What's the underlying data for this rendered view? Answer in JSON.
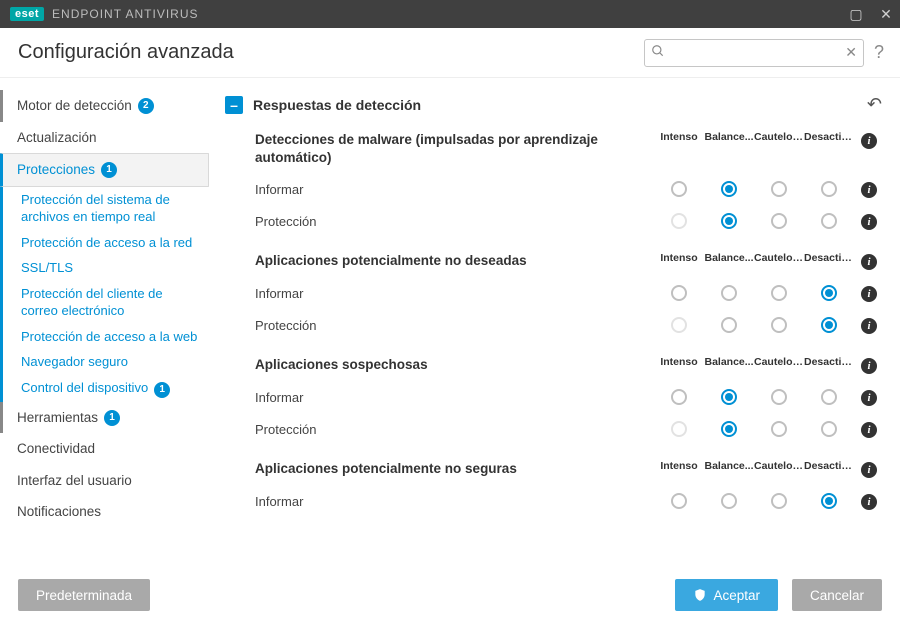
{
  "titlebar": {
    "logo": "eset",
    "product": "ENDPOINT ANTIVIRUS"
  },
  "header": {
    "title": "Configuración avanzada",
    "search_placeholder": "",
    "help": "?"
  },
  "sidebar": {
    "items": [
      {
        "label": "Motor de detección",
        "badge": "2",
        "kind": "top",
        "accent": true
      },
      {
        "label": "Actualización",
        "kind": "top"
      },
      {
        "label": "Protecciones",
        "badge": "1",
        "kind": "top",
        "active": true
      },
      {
        "label": "Protección del sistema de archivos en tiempo real",
        "kind": "sub"
      },
      {
        "label": "Protección de acceso a la red",
        "kind": "sub"
      },
      {
        "label": "SSL/TLS",
        "kind": "sub"
      },
      {
        "label": "Protección del cliente de correo electrónico",
        "kind": "sub"
      },
      {
        "label": "Protección de acceso a la web",
        "kind": "sub"
      },
      {
        "label": "Navegador seguro",
        "kind": "sub"
      },
      {
        "label": "Control del dispositivo",
        "badge": "1",
        "kind": "sub"
      },
      {
        "label": "Herramientas",
        "badge": "1",
        "kind": "top",
        "accent": true
      },
      {
        "label": "Conectividad",
        "kind": "top"
      },
      {
        "label": "Interfaz del usuario",
        "kind": "top"
      },
      {
        "label": "Notificaciones",
        "kind": "top"
      }
    ]
  },
  "section": {
    "title": "Respuestas de detección"
  },
  "columns": [
    "Intenso",
    "Balance...",
    "Cauteloso",
    "Desactiv..."
  ],
  "groups": [
    {
      "title": "Detecciones de malware (impulsadas por aprendizaje automático)",
      "rows": [
        {
          "label": "Informar",
          "selected": 1,
          "disabled": []
        },
        {
          "label": "Protección",
          "selected": 1,
          "disabled": [
            0
          ]
        }
      ]
    },
    {
      "title": "Aplicaciones potencialmente no deseadas",
      "rows": [
        {
          "label": "Informar",
          "selected": 3,
          "disabled": []
        },
        {
          "label": "Protección",
          "selected": 3,
          "disabled": [
            0
          ]
        }
      ]
    },
    {
      "title": "Aplicaciones sospechosas",
      "rows": [
        {
          "label": "Informar",
          "selected": 1,
          "disabled": []
        },
        {
          "label": "Protección",
          "selected": 1,
          "disabled": [
            0
          ]
        }
      ]
    },
    {
      "title": "Aplicaciones potencialmente no seguras",
      "rows": [
        {
          "label": "Informar",
          "selected": 3,
          "disabled": []
        }
      ]
    }
  ],
  "footer": {
    "default_btn": "Predeterminada",
    "accept_btn": "Aceptar",
    "cancel_btn": "Cancelar"
  }
}
